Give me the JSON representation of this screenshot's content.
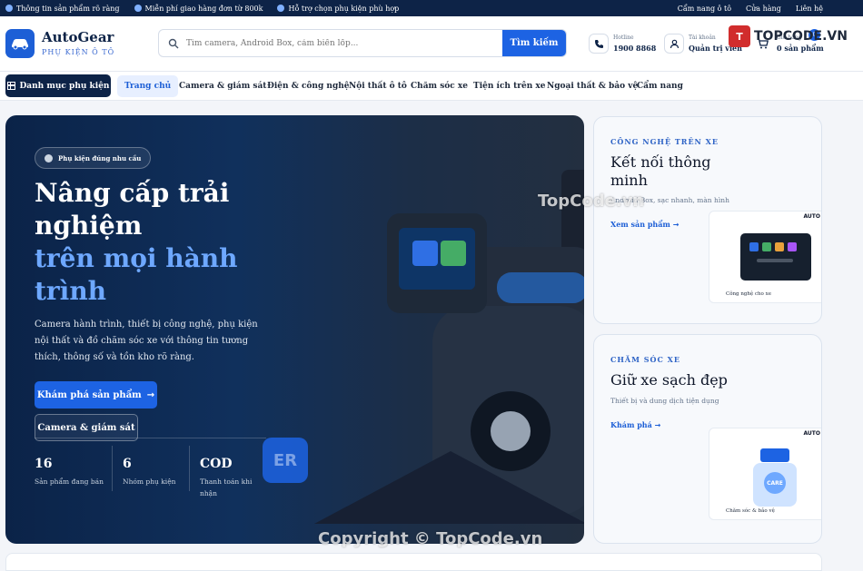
{
  "topbar": {
    "left": [
      "Thông tin sản phẩm rõ ràng",
      "Miễn phí giao hàng đơn từ 800k",
      "Hỗ trợ chọn phụ kiện phù hợp"
    ],
    "right": [
      "Cẩm nang ô tô",
      "Cửa hàng",
      "Liên hệ"
    ]
  },
  "header": {
    "brand": "AutoGear",
    "tagline": "PHỤ KIỆN Ô TÔ",
    "search_placeholder": "Tìm camera, Android Box, cảm biến lốp...",
    "search_button": "Tìm kiếm",
    "hotline_label": "Hotline",
    "hotline_value": "1900 8868",
    "account_label": "Tài khoản",
    "account_value": "Quản trị viên",
    "cart_label": "Giỏ hàng",
    "cart_value": "0 sản phẩm",
    "cart_count": "0"
  },
  "nav": {
    "category_button": "Danh mục phụ kiện",
    "items": [
      "Trang chủ",
      "Camera & giám sát",
      "Điện & công nghệ",
      "Nội thất ô tô",
      "Chăm sóc xe",
      "Tiện ích trên xe",
      "Ngoại thất & bảo vệ",
      "Cẩm nang"
    ]
  },
  "hero": {
    "chip": "Phụ kiện đúng nhu cầu",
    "title_white": "Nâng cấp trải nghiệm",
    "title_blue": "trên mọi hành trình",
    "description": "Camera hành trình, thiết bị công nghệ, phụ kiện nội thất và đồ chăm sóc xe với thông tin tương thích, thông số và tồn kho rõ ràng.",
    "primary_button": "Khám phá sản phẩm",
    "secondary_button": "Camera & giám sát",
    "stats": [
      {
        "value": "16",
        "label": "Sản phẩm đang bán"
      },
      {
        "value": "6",
        "label": "Nhóm phụ kiện"
      },
      {
        "value": "COD",
        "label": "Thanh toán khi nhận"
      }
    ],
    "deco_text": "ER"
  },
  "cards": [
    {
      "kicker": "CÔNG NGHỆ TRÊN XE",
      "title": "Kết nối thông minh",
      "desc": "Android Box, sạc nhanh, màn hình",
      "link": "Xem sản phẩm",
      "brand_tag": "AUTO",
      "caption": "Công nghệ cho xe"
    },
    {
      "kicker": "CHĂM SÓC XE",
      "title": "Giữ xe sạch đẹp",
      "desc": "Thiết bị và dung dịch tiện dụng",
      "link": "Khám phá",
      "brand_tag": "AUTO",
      "caption": "Chăm sóc & bảo vệ",
      "care_label": "CARE"
    }
  ],
  "watermarks": [
    "TopCode.vn",
    "Copyright © TopCode.vn",
    "TOPCODE.VN"
  ],
  "colors": {
    "navy": "#0d2347",
    "primary": "#1d63e3",
    "accent_blue": "#6ea8ff"
  }
}
